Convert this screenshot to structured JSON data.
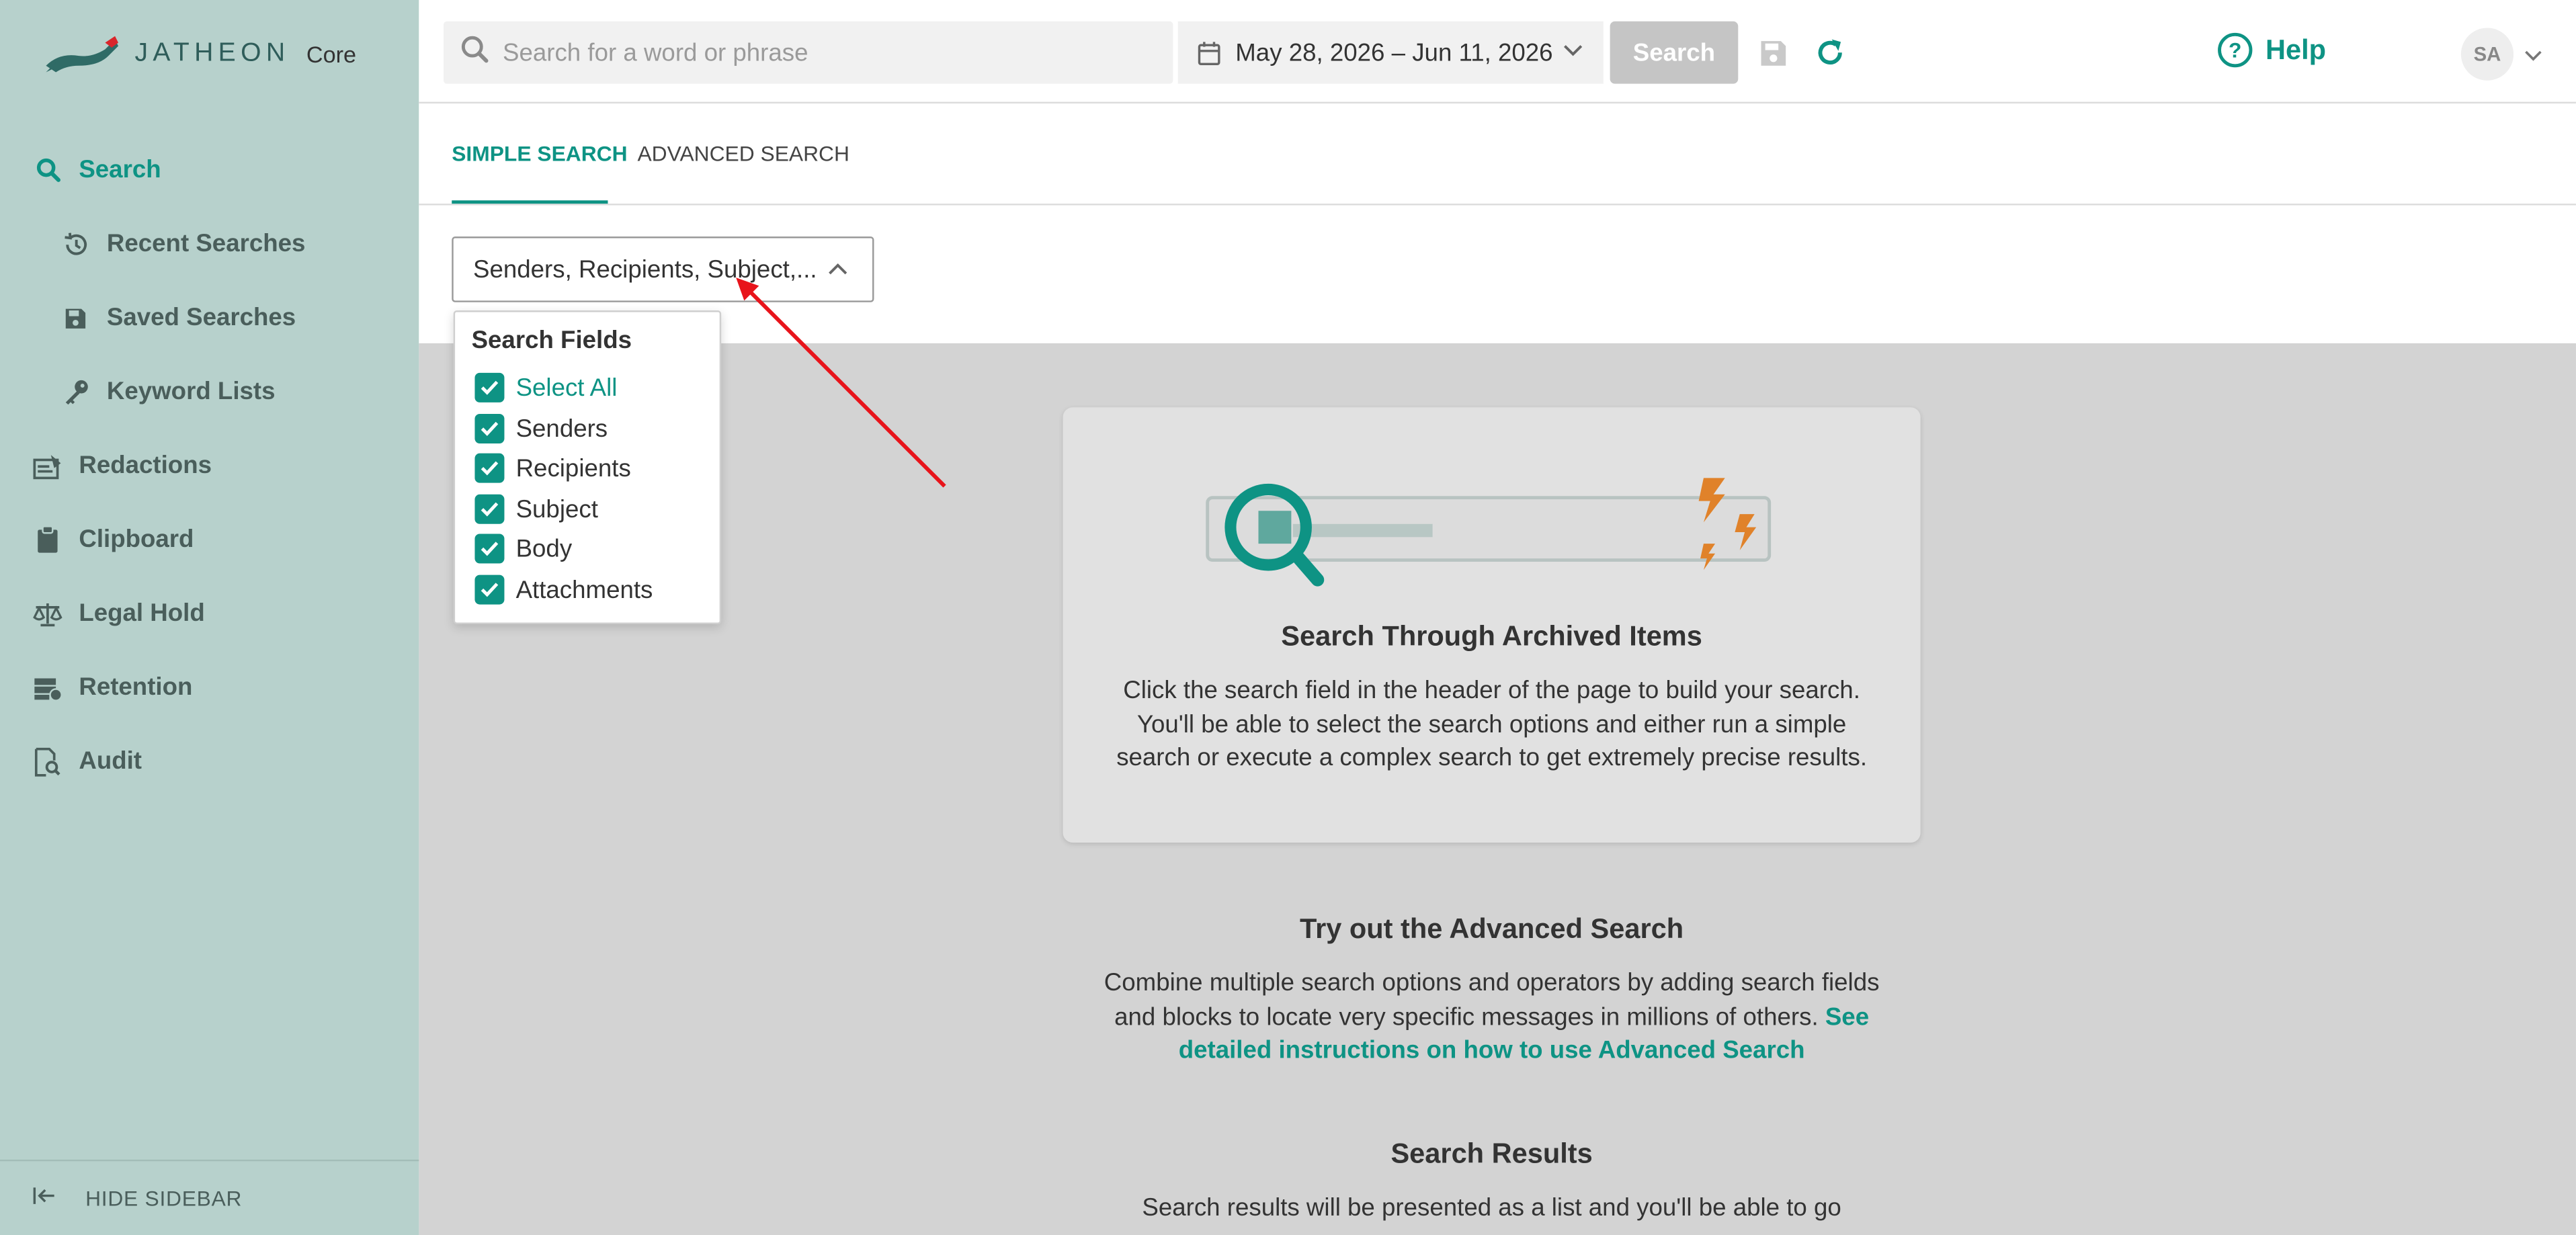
{
  "logo": {
    "brand": "JATHEON",
    "product": "Core"
  },
  "sidebar": {
    "items": [
      {
        "label": "Search",
        "icon": "search-icon",
        "active": true
      },
      {
        "label": "Recent Searches",
        "icon": "history-icon"
      },
      {
        "label": "Saved Searches",
        "icon": "floppy-icon"
      },
      {
        "label": "Keyword Lists",
        "icon": "key-icon"
      },
      {
        "label": "Redactions",
        "icon": "redaction-icon"
      },
      {
        "label": "Clipboard",
        "icon": "clipboard-icon"
      },
      {
        "label": "Legal Hold",
        "icon": "scale-icon"
      },
      {
        "label": "Retention",
        "icon": "retention-icon"
      },
      {
        "label": "Audit",
        "icon": "audit-icon"
      }
    ],
    "hide_label": "HIDE SIDEBAR"
  },
  "header": {
    "search_placeholder": "Search for a word or phrase",
    "date_range": "May 28, 2026 – Jun 11, 2026",
    "search_button": "Search",
    "help_label": "Help",
    "avatar_initials": "SA"
  },
  "tabs": [
    {
      "label": "SIMPLE SEARCH",
      "active": true
    },
    {
      "label": "ADVANCED SEARCH",
      "active": false
    }
  ],
  "fields_select": {
    "value": "Senders, Recipients, Subject,..."
  },
  "search_fields": {
    "title": "Search Fields",
    "options": [
      {
        "label": "Select All",
        "checked": true
      },
      {
        "label": "Senders",
        "checked": true
      },
      {
        "label": "Recipients",
        "checked": true
      },
      {
        "label": "Subject",
        "checked": true
      },
      {
        "label": "Body",
        "checked": true
      },
      {
        "label": "Attachments",
        "checked": true
      }
    ]
  },
  "card": {
    "title": "Search Through Archived Items",
    "text": "Click the search field in the header of the page to build your search. You'll be able to select the search options and either run a simple search or execute a complex search to get extremely precise results."
  },
  "advanced": {
    "title": "Try out the Advanced Search",
    "text": "Combine multiple search options and operators by adding search fields and blocks to locate very specific messages in millions of others.",
    "link": "See detailed instructions on how to use Advanced Search"
  },
  "results": {
    "title": "Search Results",
    "text": "Search results will be presented as a list and you'll be able to go"
  },
  "colors": {
    "accent": "#0e9384",
    "sidebar": "#b7d1cc",
    "annotation": "#e8141b"
  }
}
